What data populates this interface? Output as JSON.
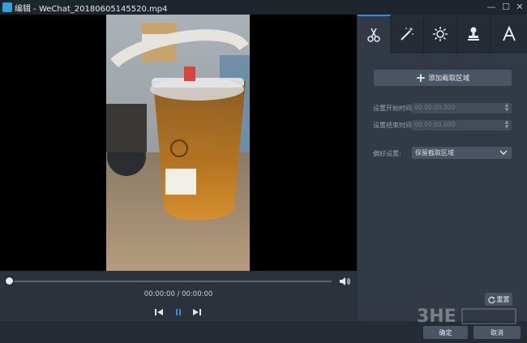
{
  "window": {
    "title": "编辑 - WeChat_20180605145520.mp4",
    "minimize_label": "—",
    "maximize_label": "☐",
    "close_label": "✕"
  },
  "player": {
    "timecode": "00:00:00 / 00:00:00",
    "progress": 0
  },
  "tabs": [
    {
      "icon": "scissors-icon",
      "active": true
    },
    {
      "icon": "magic-wand-icon",
      "active": false
    },
    {
      "icon": "brightness-icon",
      "active": false
    },
    {
      "icon": "stamp-icon",
      "active": false
    },
    {
      "icon": "text-icon",
      "active": false
    }
  ],
  "clip": {
    "add_label": "添加截取区域",
    "start_label": "设置开始时间:",
    "start_value": "00:00:00.000",
    "end_label": "设置结束时间:",
    "end_value": "00:00:00.000",
    "pref_label": "偏好设置:",
    "pref_value": "保留截取区域",
    "reset_label": "重置"
  },
  "footer": {
    "ok_label": "确定",
    "cancel_label": "取消"
  },
  "colors": {
    "accent": "#2f91e6",
    "panel": "#323a45",
    "dark": "#262c35"
  }
}
